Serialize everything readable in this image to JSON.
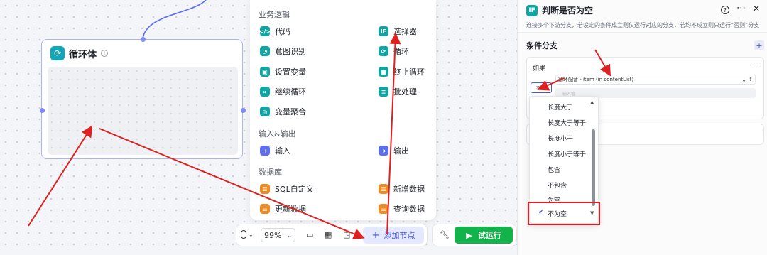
{
  "loop_node": {
    "title": "循环体",
    "icon": "loop-icon"
  },
  "menu": {
    "business_logic": {
      "title": "业务逻辑",
      "items": [
        {
          "label": "代码",
          "icon": "code-icon"
        },
        {
          "label": "选择器",
          "icon": "if-icon",
          "icon_text": "IF"
        },
        {
          "label": "意图识别",
          "icon": "bulb-icon"
        },
        {
          "label": "循环",
          "icon": "loop-icon"
        },
        {
          "label": "设置变量",
          "icon": "set-variable-icon"
        },
        {
          "label": "终止循环",
          "icon": "stop-loop-icon"
        },
        {
          "label": "继续循环",
          "icon": "continue-loop-icon"
        },
        {
          "label": "批处理",
          "icon": "batch-icon"
        },
        {
          "label": "变量聚合",
          "icon": "aggregate-icon"
        }
      ]
    },
    "io": {
      "title": "输入&输出",
      "items": [
        {
          "label": "输入",
          "icon": "input-icon"
        },
        {
          "label": "输出",
          "icon": "output-icon"
        }
      ]
    },
    "database": {
      "title": "数据库",
      "items": [
        {
          "label": "SQL自定义",
          "icon": "sql-icon"
        },
        {
          "label": "新增数据",
          "icon": "add-data-icon"
        },
        {
          "label": "更新数据",
          "icon": "update-data-icon"
        },
        {
          "label": "查询数据",
          "icon": "query-data-icon"
        }
      ]
    }
  },
  "toolbar": {
    "zoom": "99%",
    "add_node_label": "添加节点",
    "run_label": "试运行"
  },
  "right_panel": {
    "title": "判断是否为空",
    "icon_text": "IF",
    "description": "连接多个下游分支，若设定的条件成立则仅运行对应的分支，若均不成立则只运行“否则”分支",
    "section_title": "条件分支",
    "if_label": "如果",
    "operator_short": "不",
    "variable_value": "循环配音 - item (in contentList)",
    "input_placeholder": "输入值"
  },
  "dropdown": {
    "options": [
      "长度大于",
      "长度大于等于",
      "长度小于",
      "长度小于等于",
      "包含",
      "不包含",
      "为空",
      "不为空"
    ],
    "selected": "不为空"
  },
  "colors": {
    "accent": "#4656e8",
    "run": "#12b34a",
    "annotation": "#e02020",
    "teal": "#10a5a3",
    "orange": "#f08a24"
  }
}
